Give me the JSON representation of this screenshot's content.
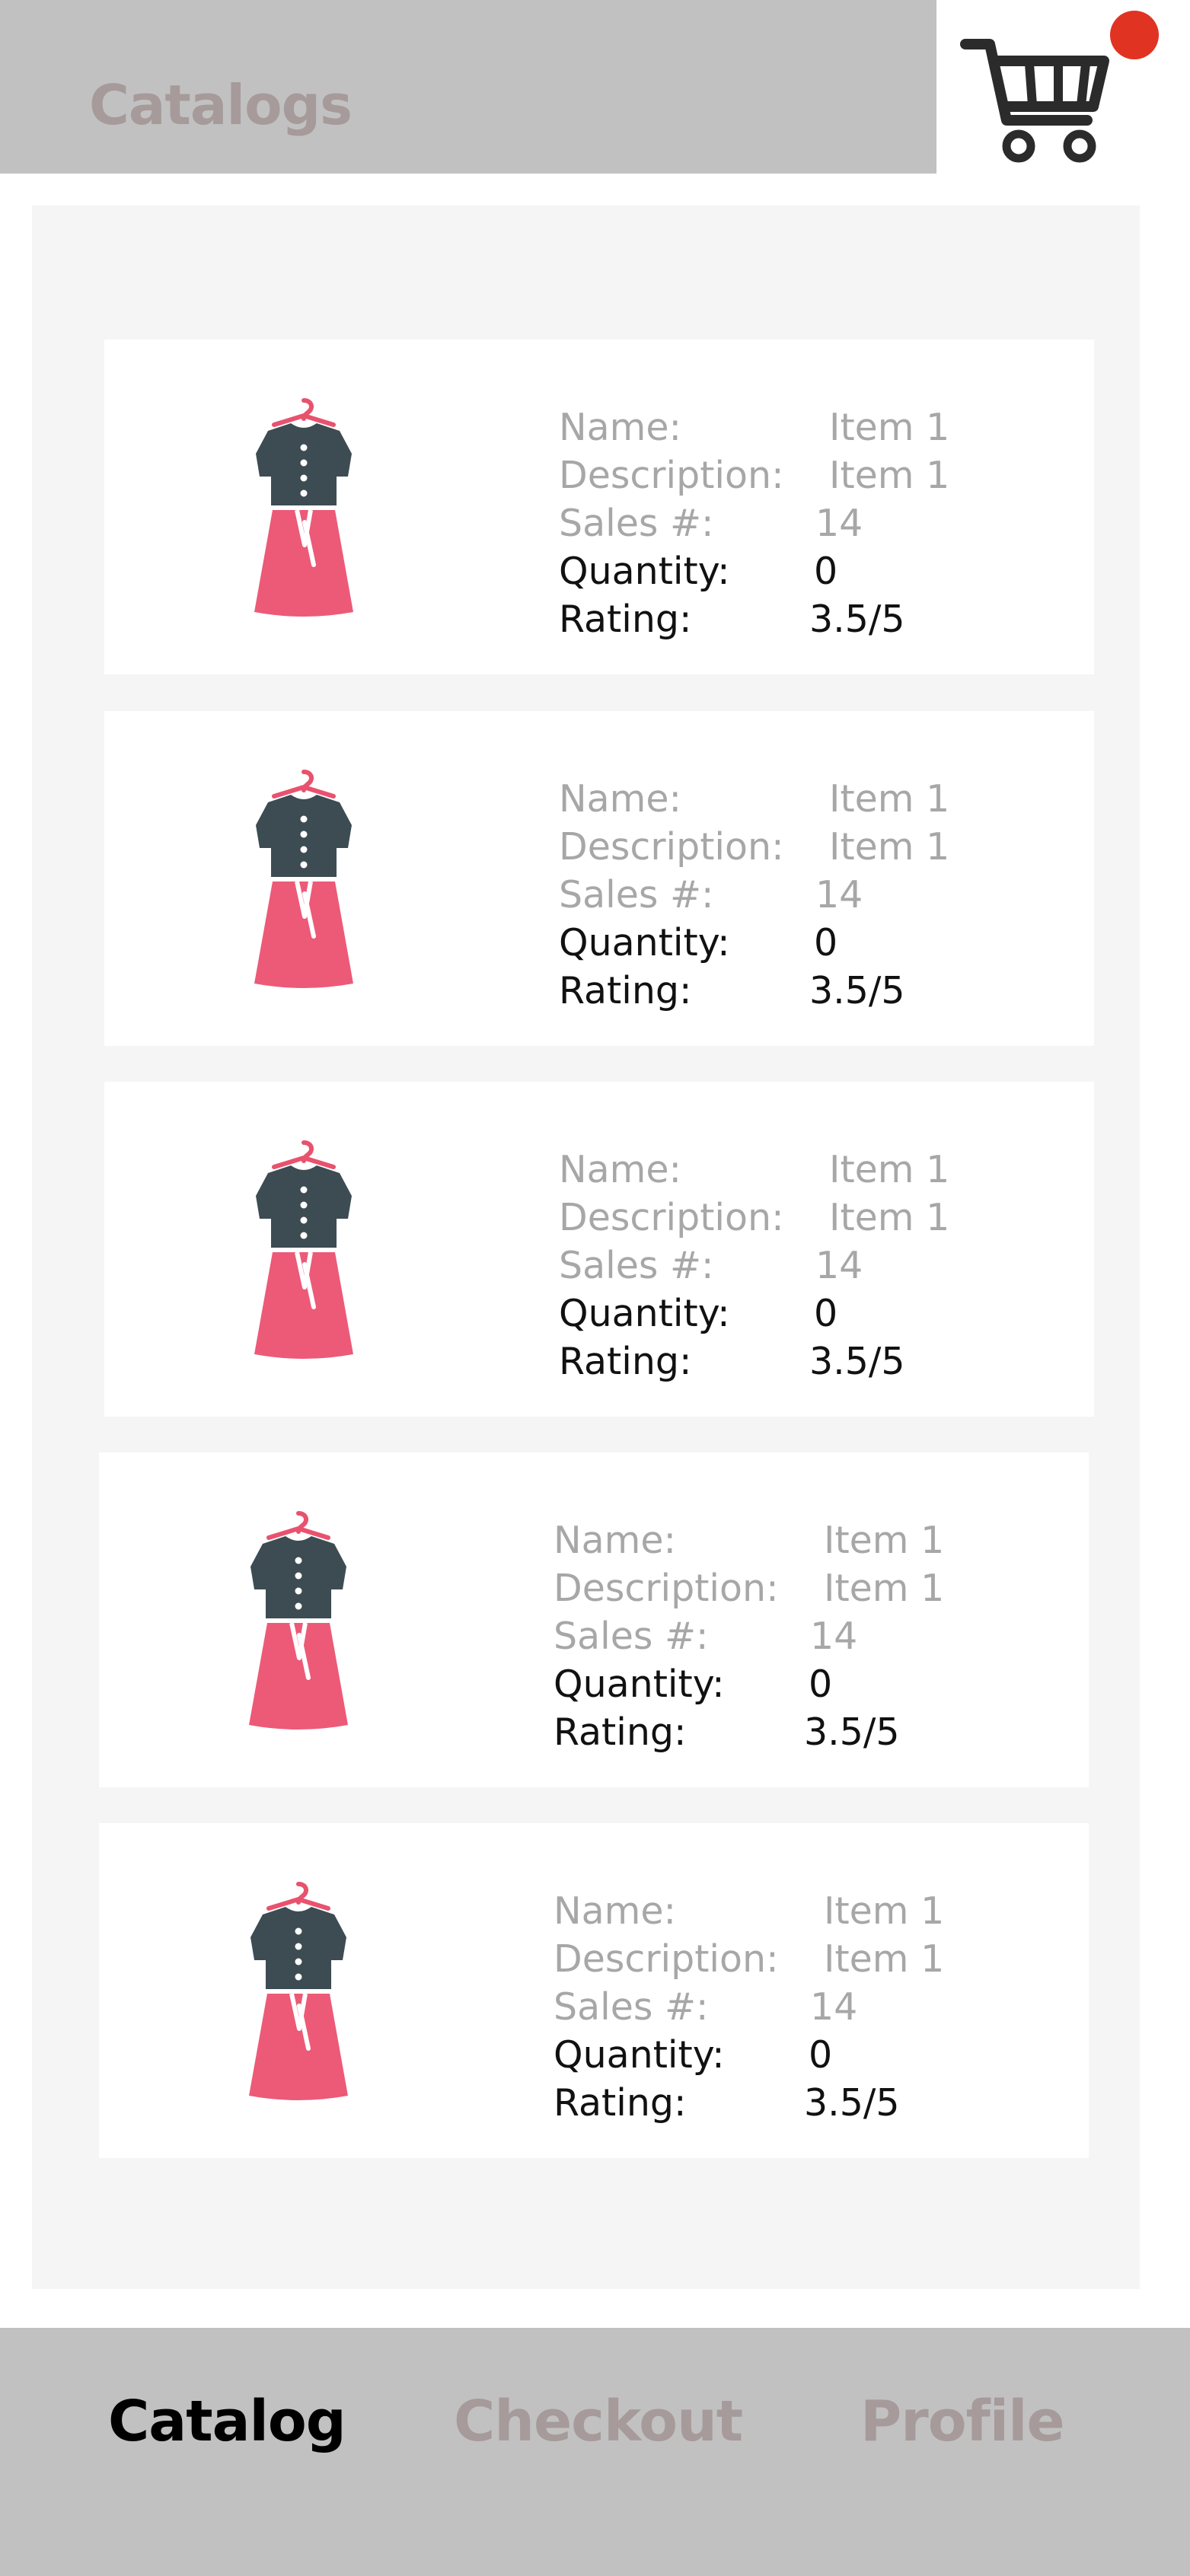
{
  "header": {
    "title": "Catalogs"
  },
  "cart": {
    "icon": "shopping-cart-icon",
    "badge_color": "#e13322"
  },
  "items": [
    {
      "image_icon": "dress-icon",
      "name_label": "Name:",
      "name_value": "Item 1",
      "description_label": "Description:",
      "description_value": "Item 1",
      "sales_label": "Sales #:",
      "sales_value": "14",
      "quantity_label": "Quantity:",
      "quantity_value": "0",
      "rating_label": "Rating:",
      "rating_value": "3.5/5"
    },
    {
      "image_icon": "dress-icon",
      "name_label": "Name:",
      "name_value": "Item 1",
      "description_label": "Description:",
      "description_value": "Item 1",
      "sales_label": "Sales #:",
      "sales_value": "14",
      "quantity_label": "Quantity:",
      "quantity_value": "0",
      "rating_label": "Rating:",
      "rating_value": "3.5/5"
    },
    {
      "image_icon": "dress-icon",
      "name_label": "Name:",
      "name_value": "Item 1",
      "description_label": "Description:",
      "description_value": "Item 1",
      "sales_label": "Sales #:",
      "sales_value": "14",
      "quantity_label": "Quantity:",
      "quantity_value": "0",
      "rating_label": "Rating:",
      "rating_value": "3.5/5"
    },
    {
      "image_icon": "dress-icon",
      "name_label": "Name:",
      "name_value": "Item 1",
      "description_label": "Description:",
      "description_value": "Item 1",
      "sales_label": "Sales #:",
      "sales_value": "14",
      "quantity_label": "Quantity:",
      "quantity_value": "0",
      "rating_label": "Rating:",
      "rating_value": "3.5/5"
    },
    {
      "image_icon": "dress-icon",
      "name_label": "Name:",
      "name_value": "Item 1",
      "description_label": "Description:",
      "description_value": "Item 1",
      "sales_label": "Sales #:",
      "sales_value": "14",
      "quantity_label": "Quantity:",
      "quantity_value": "0",
      "rating_label": "Rating:",
      "rating_value": "3.5/5"
    }
  ],
  "nav": {
    "catalog": "Catalog",
    "checkout": "Checkout",
    "profile": "Profile",
    "active_color": "#000000",
    "inactive_color": "#a69a9a"
  }
}
